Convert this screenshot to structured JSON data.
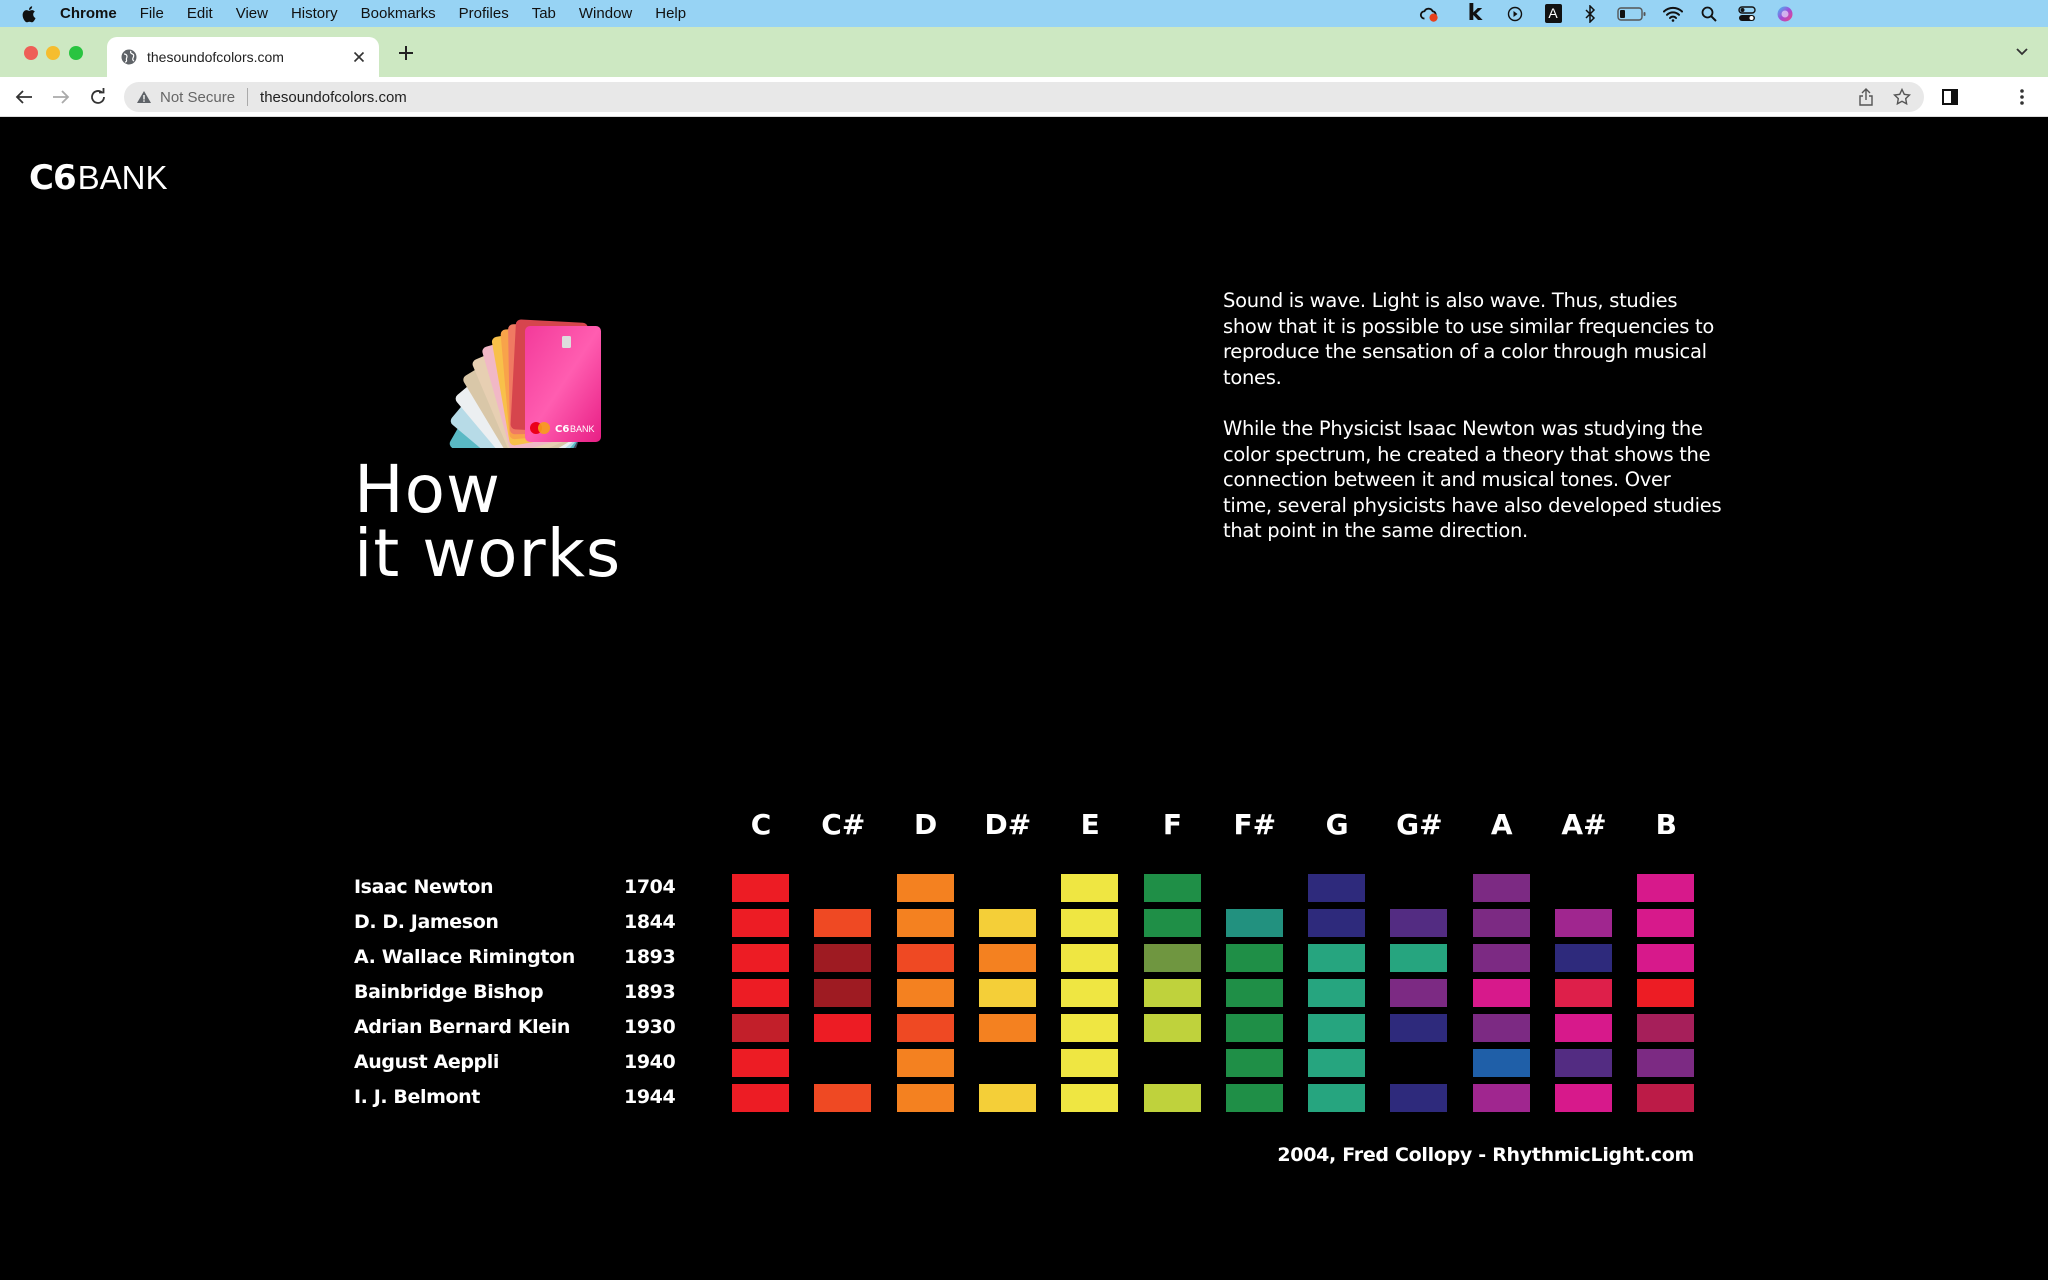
{
  "menubar": {
    "app_name": "Chrome",
    "items": [
      "File",
      "Edit",
      "View",
      "History",
      "Bookmarks",
      "Profiles",
      "Tab",
      "Window",
      "Help"
    ],
    "status_icons": [
      "creative-cloud-icon",
      "k-app-icon",
      "play-circle-icon",
      "keyboard-input-a-icon",
      "bluetooth-icon",
      "battery-icon",
      "wifi-icon",
      "spotlight-search-icon",
      "control-center-icon",
      "siri-icon"
    ]
  },
  "browser": {
    "tab_title": "thesoundofcolors.com",
    "security_label": "Not Secure",
    "url": "thesoundofcolors.com"
  },
  "page": {
    "logo_mark": "C6",
    "logo_word": "BANK",
    "heading_line1": "How",
    "heading_line2": "it works",
    "paragraphs": [
      "Sound is wave. Light is also wave. Thus, studies show that it is possible to use similar frequencies to reproduce the sensation of a color through musical tones.",
      "While the Physicist Isaac Newton was studying the color spectrum, he created a theory that shows the connection between it and musical tones. Over time, several physicists have also developed studies that point in the same direction."
    ],
    "credit": "2004, Fred Collopy - RhythmicLight.com"
  },
  "color_table": {
    "notes": [
      "C",
      "C#",
      "D",
      "D#",
      "E",
      "F",
      "F#",
      "G",
      "G#",
      "A",
      "A#",
      "B"
    ],
    "rows": [
      {
        "name": "Isaac Newton",
        "year": "1704",
        "colors": [
          "#ed1c24",
          null,
          "#f48120",
          null,
          "#efe642",
          "#1f8f47",
          null,
          "#2e2a7c",
          null,
          "#7c2a83",
          null,
          "#d7198b"
        ]
      },
      {
        "name": "D. D. Jameson",
        "year": "1844",
        "colors": [
          "#ed1c24",
          "#ef4923",
          "#f48120",
          "#f4cf38",
          "#efe642",
          "#1f8f47",
          "#22917f",
          "#2e2a7c",
          "#532c82",
          "#7c2a83",
          "#a0268f",
          "#d7198b"
        ]
      },
      {
        "name": "A. Wallace Rimington",
        "year": "1893",
        "colors": [
          "#ed1c24",
          "#9e1b22",
          "#ef4923",
          "#f48120",
          "#efe642",
          "#6f9640",
          "#1f8f47",
          "#26a57f",
          "#26a57f",
          "#7c2a83",
          "#2e2a7c",
          "#d7198b"
        ]
      },
      {
        "name": "Bainbridge Bishop",
        "year": "1893",
        "colors": [
          "#ed1c24",
          "#9e1b22",
          "#f48120",
          "#f4cf38",
          "#efe642",
          "#bfd23c",
          "#1f8f47",
          "#26a57f",
          "#7c2a83",
          "#d7198b",
          "#de1f4a",
          "#ed1c24"
        ]
      },
      {
        "name": "Adrian Bernard Klein",
        "year": "1930",
        "colors": [
          "#c21f2a",
          "#ed1c24",
          "#ef4923",
          "#f48120",
          "#efe642",
          "#bfd23c",
          "#1f8f47",
          "#26a57f",
          "#2e2a7c",
          "#7c2a83",
          "#d7198b",
          "#a61f5a"
        ]
      },
      {
        "name": "August Aeppli",
        "year": "1940",
        "colors": [
          "#ed1c24",
          null,
          "#f48120",
          null,
          "#efe642",
          null,
          "#1f8f47",
          "#26a57f",
          null,
          "#1f5fa8",
          "#532c82",
          "#7c2a83"
        ]
      },
      {
        "name": "I. J. Belmont",
        "year": "1944",
        "colors": [
          "#ed1c24",
          "#ef4923",
          "#f48120",
          "#f4cf38",
          "#efe642",
          "#bfd23c",
          "#1f8f47",
          "#26a57f",
          "#2e2a7c",
          "#a0268f",
          "#d7198b",
          "#bc1b47"
        ]
      }
    ]
  }
}
